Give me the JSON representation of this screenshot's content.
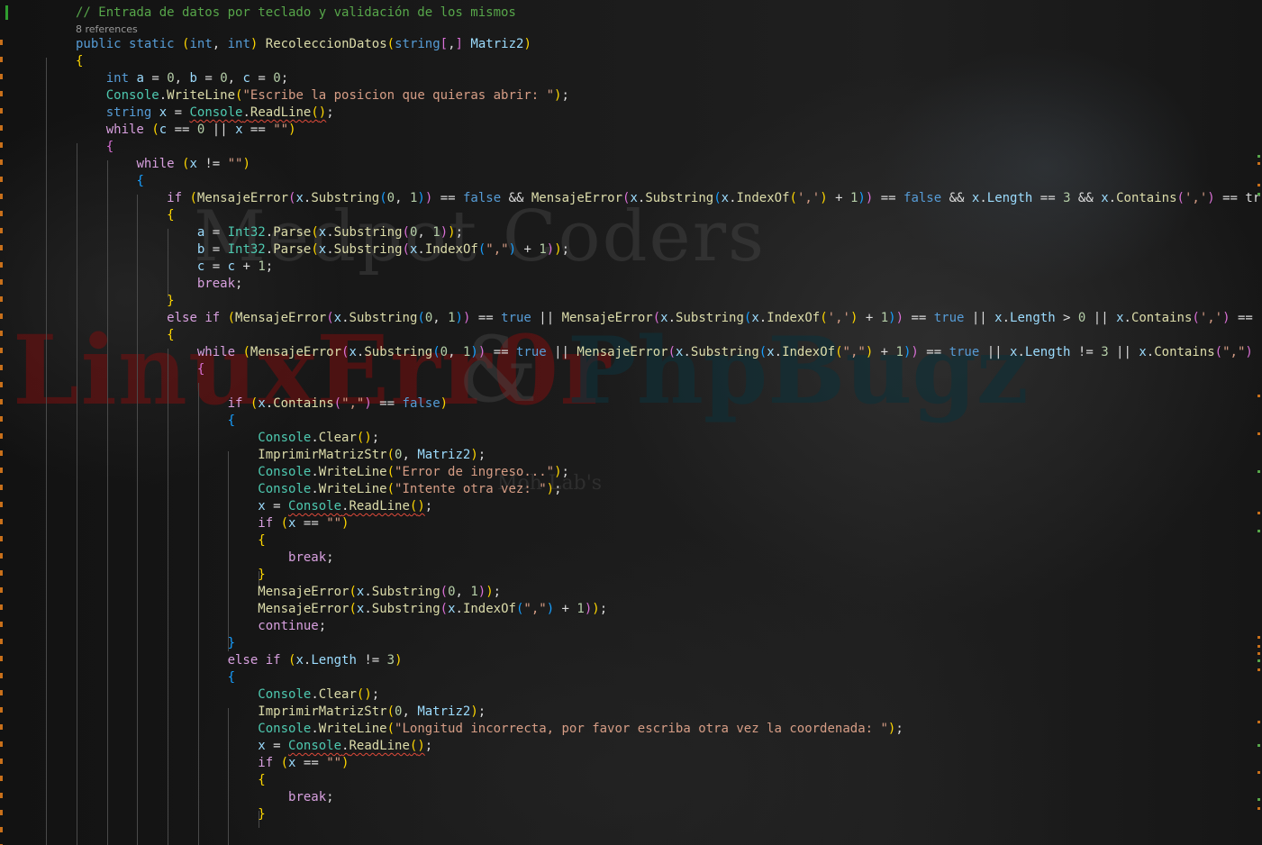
{
  "editor": {
    "language": "C#",
    "background_watermark": {
      "line1": "Medpot Coders",
      "line2_red": "LinuxErr0r",
      "line2_amp": "&",
      "line2_teal": "PhpBugz",
      "line3": "Moh Lab's"
    },
    "codelens": "8 references",
    "code_lines": [
      "// Entrada de datos por teclado y validación de los mismos",
      "public static (int, int) RecoleccionDatos(string[,] Matriz2)",
      "{",
      "    int a = 0, b = 0, c = 0;",
      "    Console.WriteLine(\"Escribe la posicion que quieras abrir: \");",
      "    string x = Console.ReadLine();",
      "    while (c == 0 || x == \"\")",
      "    {",
      "        while (x != \"\")",
      "        {",
      "            if (MensajeError(x.Substring(0, 1)) == false && MensajeError(x.Substring(x.IndexOf(',') + 1)) == false && x.Length == 3 && x.Contains(',') == tr",
      "            {",
      "                a = Int32.Parse(x.Substring(0, 1));",
      "                b = Int32.Parse(x.Substring(x.IndexOf(\",\") + 1));",
      "                c = c + 1;",
      "                break;",
      "            }",
      "            else if (MensajeError(x.Substring(0, 1)) == true || MensajeError(x.Substring(x.IndexOf(',') + 1)) == true || x.Length > 0 || x.Contains(',') ==",
      "            {",
      "                while (MensajeError(x.Substring(0, 1)) == true || MensajeError(x.Substring(x.IndexOf(\",\") + 1)) == true || x.Length != 3 || x.Contains(\",\")",
      "                {",
      "",
      "                    if (x.Contains(\",\") == false)",
      "                    {",
      "                        Console.Clear();",
      "                        ImprimirMatrizStr(0, Matriz2);",
      "                        Console.WriteLine(\"Error de ingreso...\");",
      "                        Console.WriteLine(\"Intente otra vez: \");",
      "                        x = Console.ReadLine();",
      "                        if (x == \"\")",
      "                        {",
      "                            break;",
      "                        }",
      "                        MensajeError(x.Substring(0, 1));",
      "                        MensajeError(x.Substring(x.IndexOf(\",\") + 1));",
      "                        continue;",
      "                    }",
      "                    else if (x.Length != 3)",
      "                    {",
      "                        Console.Clear();",
      "                        ImprimirMatrizStr(0, Matriz2);",
      "                        Console.WriteLine(\"Longitud incorrecta, por favor escriba otra vez la coordenada: \");",
      "                        x = Console.ReadLine();",
      "                        if (x == \"\")",
      "                        {",
      "                            break;",
      "                        }"
    ]
  },
  "colors": {
    "keyword": "#569cd6",
    "comment": "#57a64a",
    "string": "#d69d85",
    "method": "#dcdcaa",
    "type": "#4ec9b0",
    "identifier": "#9cdcfe",
    "number": "#b5cea8",
    "control": "#d8a0df",
    "squiggle": "#e04a3a",
    "change_bar": "#c9701a",
    "saved_bar": "#2f9d2f"
  }
}
